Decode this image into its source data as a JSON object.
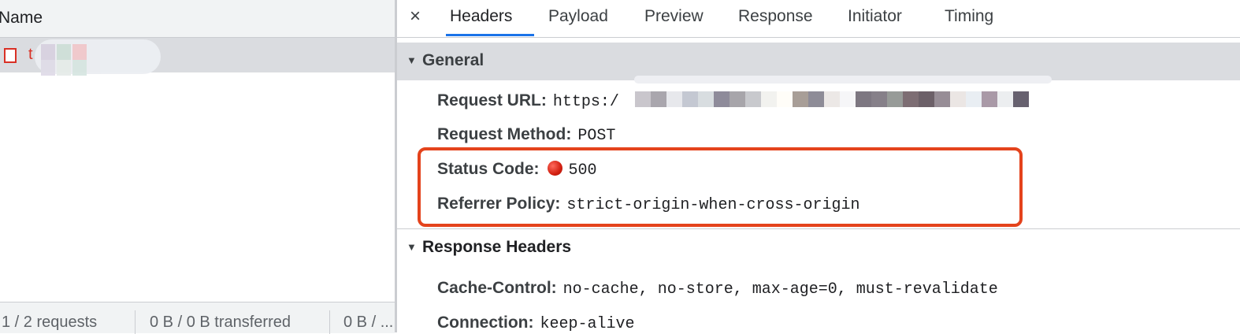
{
  "left_panel": {
    "name_header": "Name",
    "request": {
      "name": "t"
    },
    "status_bar": [
      "1 / 2 requests",
      "0 B / 0 B transferred",
      "0 B / ..."
    ]
  },
  "tabs": {
    "close": "×",
    "items": [
      "Headers",
      "Payload",
      "Preview",
      "Response",
      "Initiator",
      "Timing"
    ],
    "active": "Headers"
  },
  "general": {
    "title": "General",
    "request_url": {
      "key": "Request URL:",
      "value": "https:/"
    },
    "request_method": {
      "key": "Request Method:",
      "value": "POST"
    },
    "status_code": {
      "key": "Status Code:",
      "value": "500"
    },
    "referrer_policy": {
      "key": "Referrer Policy:",
      "value": "strict-origin-when-cross-origin"
    }
  },
  "response_headers": {
    "title": "Response Headers",
    "cache_control": {
      "key": "Cache-Control:",
      "value": "no-cache, no-store, max-age=0, must-revalidate"
    },
    "connection": {
      "key": "Connection:",
      "value": "keep-alive"
    }
  },
  "colors": {
    "accent": "#1a73e8",
    "error": "#d93025",
    "highlight_box": "#e4431c"
  }
}
